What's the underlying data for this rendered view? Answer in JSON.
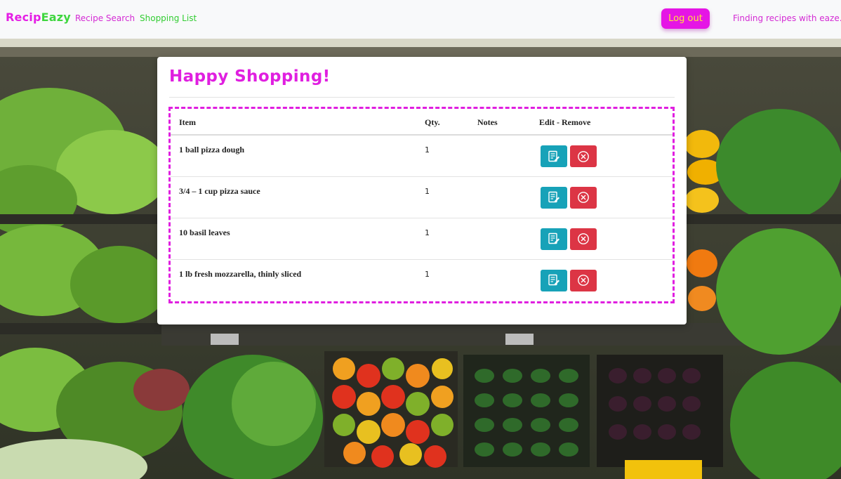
{
  "navbar": {
    "brand_part1": "Recip",
    "brand_part2": "Eazy",
    "links": [
      {
        "label": "Recipe Search"
      },
      {
        "label": "Shopping List"
      }
    ],
    "logout_label": "Log out",
    "tagline": "Finding recipes with eaze."
  },
  "page": {
    "title": "Happy Shopping!"
  },
  "table": {
    "headers": {
      "item": "Item",
      "qty": "Qty.",
      "notes": "Notes",
      "actions": "Edit - Remove"
    },
    "rows": [
      {
        "item": "1 ball pizza dough",
        "qty": "1",
        "notes": ""
      },
      {
        "item": "3/4 – 1 cup pizza sauce",
        "qty": "1",
        "notes": ""
      },
      {
        "item": "10 basil leaves",
        "qty": "1",
        "notes": ""
      },
      {
        "item": "1 lb fresh mozzarella, thinly sliced",
        "qty": "1",
        "notes": ""
      }
    ]
  },
  "icons": {
    "edit": "edit-note-icon",
    "remove": "circle-x-icon"
  },
  "colors": {
    "brand_pink": "#e01fe0",
    "brand_green": "#32cd32",
    "logout_bg": "#e515e5",
    "logout_text": "#ffe23a",
    "edit_button": "#17a2b8",
    "remove_button": "#dc3545"
  }
}
